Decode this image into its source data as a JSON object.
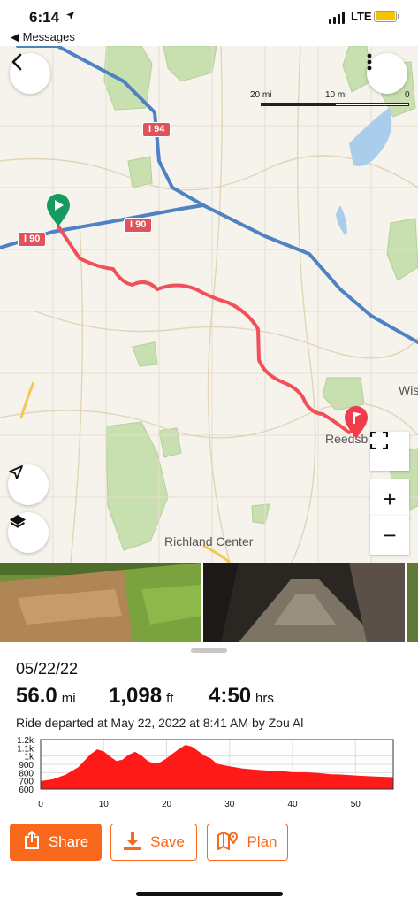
{
  "status_bar": {
    "time": "6:14",
    "location_icon": "location-arrow-icon",
    "back_app": "◀ Messages",
    "network": "LTE",
    "battery_color": "#f5c400"
  },
  "map": {
    "scale": {
      "left": "20 mi",
      "middle": "10 mi",
      "right": "0"
    },
    "highway_labels": [
      "I 94",
      "I 90",
      "I 90"
    ],
    "places": {
      "reedsburg": "Reedsb",
      "wis": "Wis",
      "richland": "Richland Center"
    },
    "route_color": "#f0505a",
    "start_marker_color": "#159b5e",
    "end_marker_color": "#ef3d4b",
    "buttons": {
      "back": "chevron-left-icon",
      "more": "more-vertical-icon",
      "fullscreen": "fullscreen-icon",
      "locate": "navigation-arrow-icon",
      "layers": "layers-icon",
      "zoom_in": "+",
      "zoom_out": "−"
    }
  },
  "ride": {
    "date": "05/22/22",
    "distance": {
      "value": "56.0",
      "unit": "mi"
    },
    "elevation": {
      "value": "1,098",
      "unit": "ft"
    },
    "duration": {
      "value": "4:50",
      "unit": "hrs"
    },
    "description": "Ride departed at May 22, 2022 at 8:41 AM by Zou Al"
  },
  "chart_data": {
    "type": "area",
    "y_ticks": [
      "1.2k",
      "1.1k",
      "1k",
      "900",
      "800",
      "700",
      "600"
    ],
    "ylim": [
      600,
      1200
    ],
    "x_ticks": [
      "0",
      "10",
      "20",
      "30",
      "40",
      "50"
    ],
    "xlim": [
      0,
      56
    ],
    "color": "#ff1a1a",
    "x": [
      0,
      2,
      4,
      6,
      8,
      9,
      10,
      11,
      12,
      13,
      14,
      15,
      16,
      17,
      18,
      19,
      20,
      21,
      22,
      23,
      24,
      25,
      26,
      27,
      28,
      30,
      32,
      34,
      36,
      38,
      40,
      42,
      44,
      46,
      48,
      50,
      52,
      54,
      56
    ],
    "y": [
      690,
      715,
      770,
      860,
      1020,
      1075,
      1050,
      990,
      935,
      950,
      1010,
      1045,
      1000,
      935,
      905,
      920,
      965,
      1025,
      1080,
      1130,
      1110,
      1055,
      1000,
      965,
      900,
      870,
      845,
      830,
      820,
      815,
      800,
      800,
      790,
      775,
      770,
      760,
      752,
      745,
      740
    ]
  },
  "actions": {
    "share": {
      "label": "Share",
      "icon": "share-icon"
    },
    "save": {
      "label": "Save",
      "icon": "download-icon"
    },
    "plan": {
      "label": "Plan",
      "icon": "map-pin-icon"
    }
  },
  "colors": {
    "accent": "#f8691e"
  }
}
